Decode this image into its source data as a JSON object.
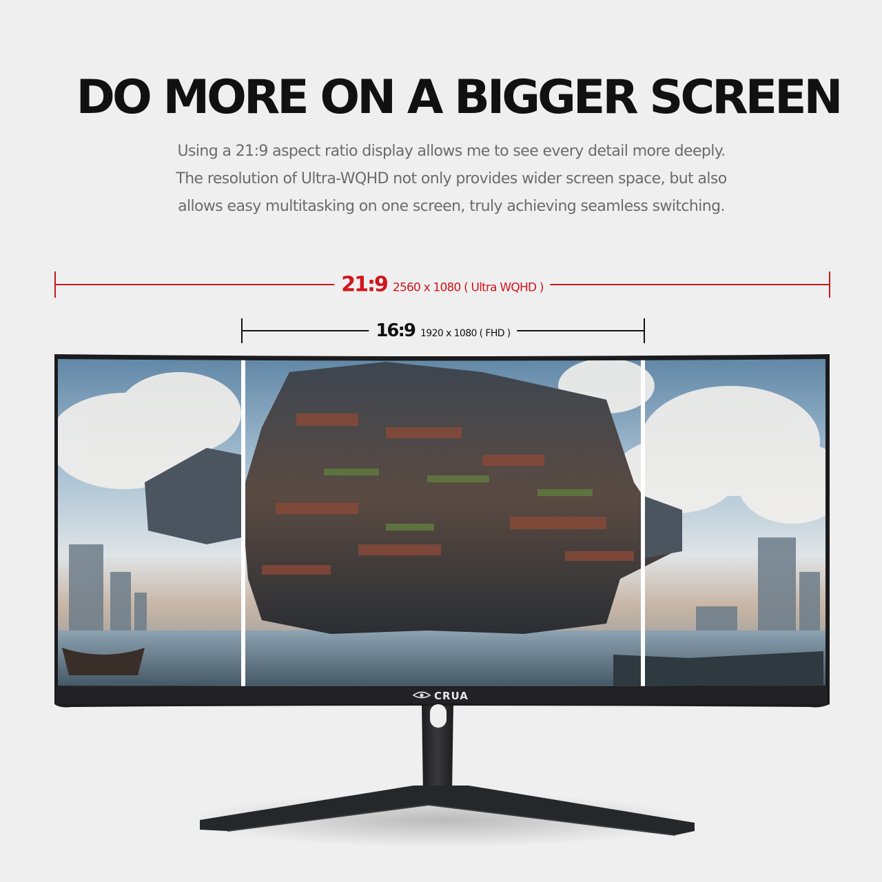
{
  "headline": "DO MORE ON A BIGGER SCREEN",
  "subtext": [
    "Using a 21:9 aspect ratio display allows me to see every detail more deeply.",
    "The resolution of Ultra-WQHD not only provides wider screen space, but also",
    "allows easy multitasking on one screen, truly achieving seamless switching."
  ],
  "ultrawide": {
    "ratio": "21:9",
    "resolution": "2560 x 1080 ( Ultra WQHD )"
  },
  "standard": {
    "ratio": "16:9",
    "resolution": "1920 x 1080 ( FHD )"
  },
  "brand": "CRUA",
  "colors": {
    "accent": "#d1141c",
    "text": "#111111",
    "subtext": "#6b6b6b",
    "background": "#efefef"
  }
}
